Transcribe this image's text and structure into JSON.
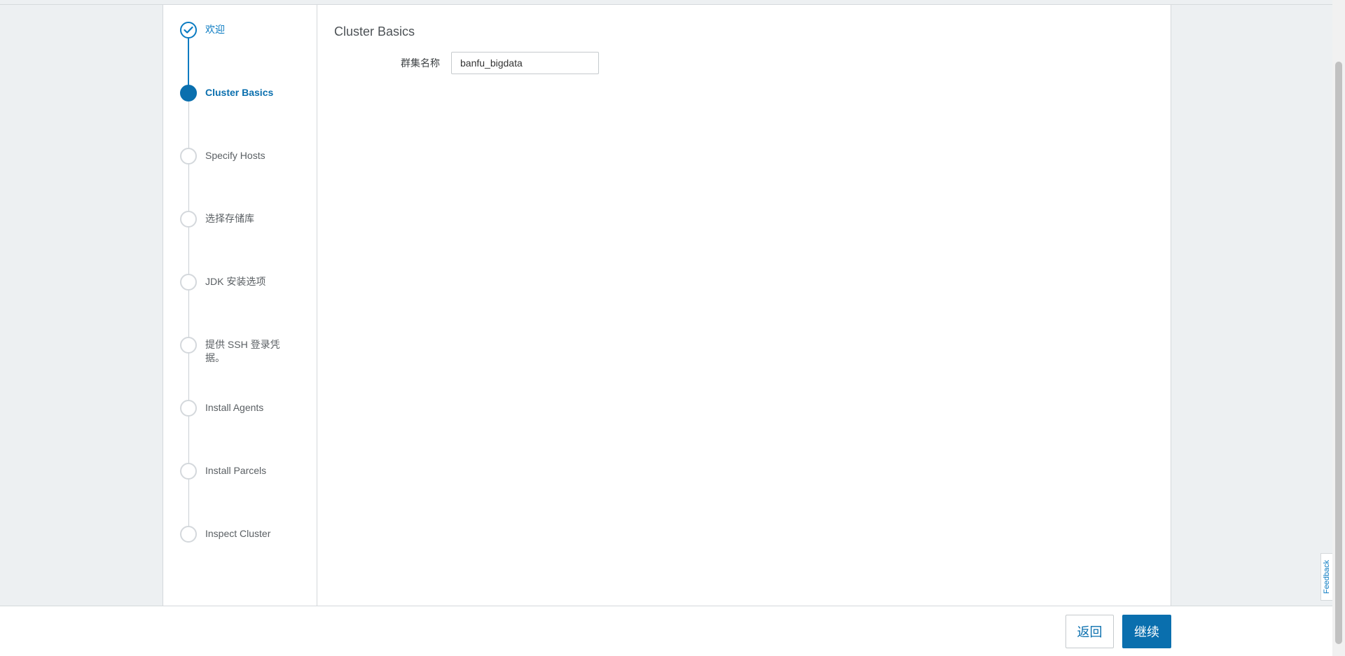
{
  "steps": [
    {
      "label": "欢迎",
      "state": "done"
    },
    {
      "label": "Cluster Basics",
      "state": "active"
    },
    {
      "label": "Specify Hosts",
      "state": "pending"
    },
    {
      "label": "选择存储库",
      "state": "pending"
    },
    {
      "label": "JDK 安装选项",
      "state": "pending"
    },
    {
      "label": "提供 SSH 登录凭据。",
      "state": "pending"
    },
    {
      "label": "Install Agents",
      "state": "pending"
    },
    {
      "label": "Install Parcels",
      "state": "pending"
    },
    {
      "label": "Inspect Cluster",
      "state": "pending"
    }
  ],
  "main": {
    "title": "Cluster Basics",
    "cluster_name_label": "群集名称",
    "cluster_name_value": "banfu_bigdata"
  },
  "footer": {
    "back_label": "返回",
    "continue_label": "继续"
  },
  "feedback": {
    "label": "Feedback"
  },
  "colors": {
    "accent": "#0a6fae",
    "accent_light": "#0a7bc2",
    "background": "#edf0f2"
  }
}
